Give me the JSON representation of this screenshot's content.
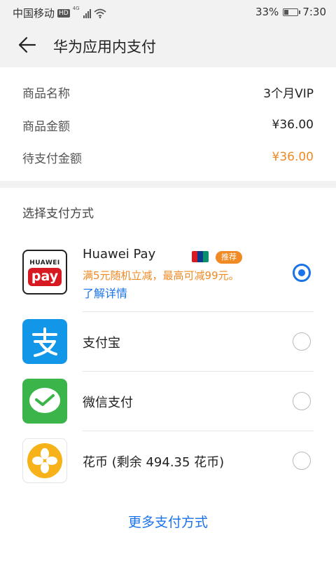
{
  "status_bar": {
    "carrier": "中国移动",
    "hd": "HD",
    "network": "4G",
    "battery": "33%",
    "battery_level": 0.33,
    "time": "7:30"
  },
  "header": {
    "title": "华为应用内支付"
  },
  "order": {
    "rows": [
      {
        "label": "商品名称",
        "value": "3个月VIP"
      },
      {
        "label": "商品金额",
        "value": "¥36.00"
      },
      {
        "label": "待支付金额",
        "value": "¥36.00"
      }
    ]
  },
  "payment": {
    "section_title": "选择支付方式",
    "methods": [
      {
        "name": "Huawei Pay",
        "logo_text_top": "HUAWEI",
        "logo_text_bottom": "pay",
        "badge": "推荐",
        "promo": "满5元随机立减，最高可减99元。",
        "details_link": "了解详情",
        "selected": true
      },
      {
        "name": "支付宝",
        "selected": false
      },
      {
        "name": "微信支付",
        "selected": false
      },
      {
        "name": "花币 (剩余 494.35 花币)",
        "selected": false
      }
    ],
    "more": "更多支付方式"
  },
  "colors": {
    "accent": "#1a73e8",
    "orange": "#f08a24",
    "alipay": "#1296e8",
    "wechat": "#3bb449",
    "huabi": "#f7b21a",
    "huawei_red": "#d71a21"
  },
  "icons": [
    "back-arrow-icon",
    "signal-icon",
    "wifi-icon",
    "battery-icon",
    "unionpay-icon",
    "alipay-icon",
    "wechat-pay-icon",
    "huabi-coin-icon"
  ]
}
